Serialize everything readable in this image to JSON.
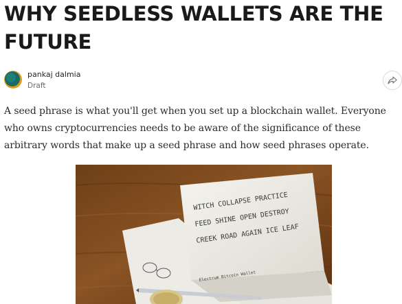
{
  "article": {
    "title": "WHY SEEDLESS WALLETS ARE THE FUTURE",
    "author": {
      "name": "pankaj dalmia",
      "status": "Draft"
    },
    "share_icon": "share-icon",
    "body": "A seed phrase is what you'll get when you set up a blockchain wallet. Everyone who owns cryptocurrencies needs to be aware of the significance of these arbitrary words that make up a seed phrase and how seed phrases operate."
  },
  "photo": {
    "card_words": [
      "WITCH COLLAPSE PRACTICE",
      "FEED   SHINE OPEN DESTROY",
      "CREEK ROAD AGAIN ICE LEAF"
    ],
    "card_footer": "Electrum  Bitcoin  Wallet"
  }
}
